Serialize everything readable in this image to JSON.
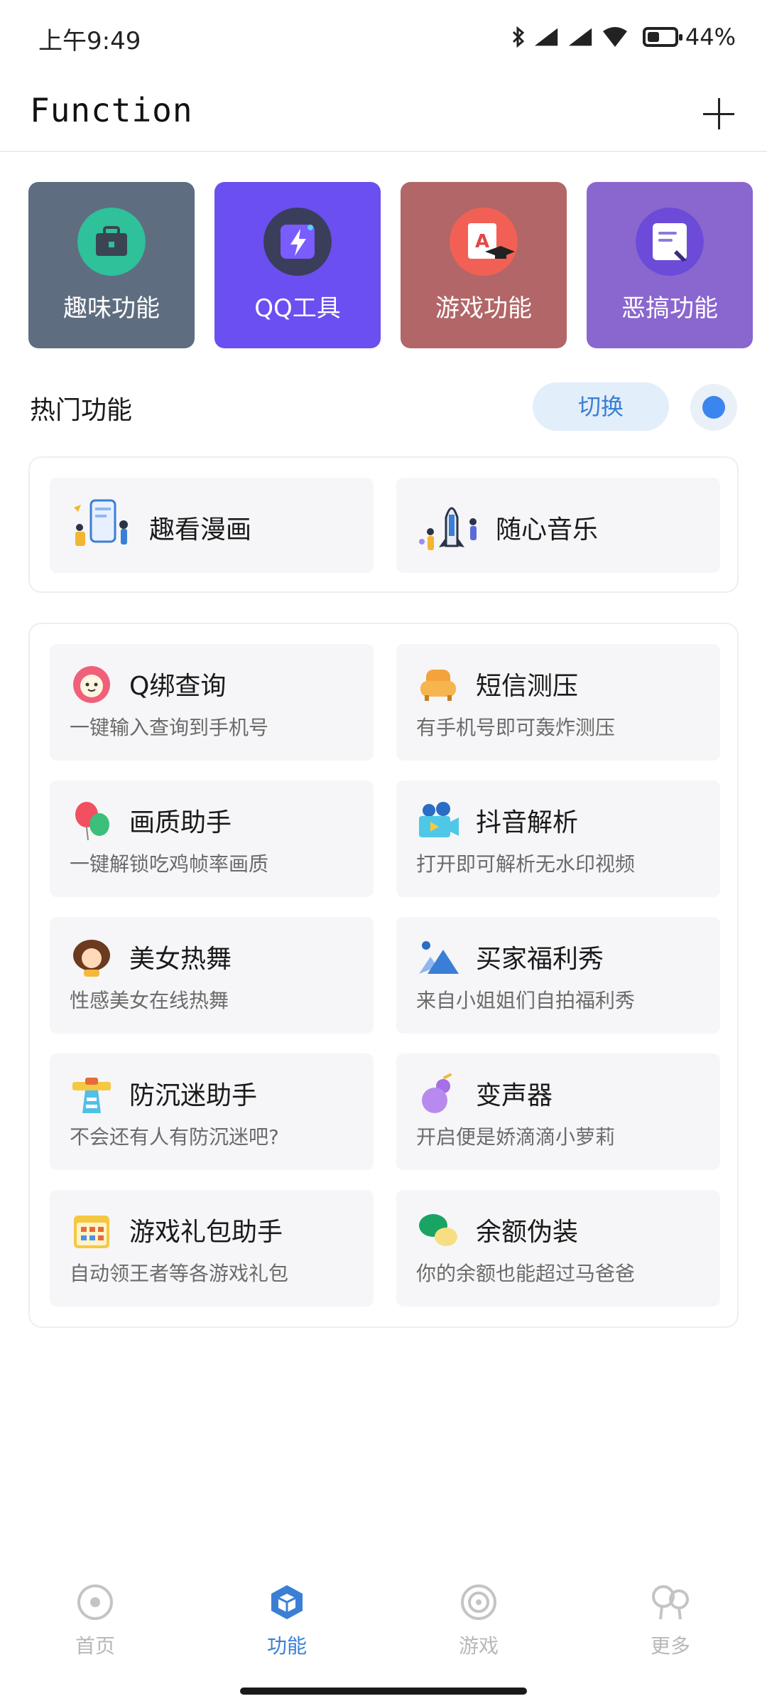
{
  "status_bar": {
    "time": "上午9:49",
    "battery": "44%",
    "battery_level": 0.44
  },
  "header": {
    "title": "Function"
  },
  "categories": [
    {
      "label": "趣味功能",
      "bg": "#5f6d80",
      "icon": "briefcase-icon"
    },
    {
      "label": "QQ工具",
      "bg": "#6b4ff0",
      "icon": "lightning-icon"
    },
    {
      "label": "游戏功能",
      "bg": "#b26667",
      "icon": "exam-grade-icon"
    },
    {
      "label": "恶搞功能",
      "bg": "#8a66cf",
      "icon": "note-icon"
    }
  ],
  "hot": {
    "title": "热门功能",
    "switch_label": "切换",
    "items": [
      {
        "label": "趣看漫画",
        "icon": "phone-illustration-icon"
      },
      {
        "label": "随心音乐",
        "icon": "rocket-illustration-icon"
      }
    ]
  },
  "functions": [
    {
      "title": "Q绑查询",
      "desc": "一键输入查询到手机号",
      "icon": "flower-face-icon"
    },
    {
      "title": "短信测压",
      "desc": "有手机号即可轰炸测压",
      "icon": "sofa-icon"
    },
    {
      "title": "画质助手",
      "desc": "一键解锁吃鸡帧率画质",
      "icon": "balloon-icon"
    },
    {
      "title": "抖音解析",
      "desc": "打开即可解析无水印视频",
      "icon": "video-camera-icon"
    },
    {
      "title": "美女热舞",
      "desc": "性感美女在线热舞",
      "icon": "girl-avatar-icon"
    },
    {
      "title": "买家福利秀",
      "desc": "来自小姐姐们自拍福利秀",
      "icon": "mountain-image-icon"
    },
    {
      "title": "防沉迷助手",
      "desc": "不会还有人有防沉迷吧?",
      "icon": "lighthouse-icon"
    },
    {
      "title": "变声器",
      "desc": "开启便是娇滴滴小萝莉",
      "icon": "gourd-icon"
    },
    {
      "title": "游戏礼包助手",
      "desc": "自动领王者等各游戏礼包",
      "icon": "calendar-icon"
    },
    {
      "title": "余额伪装",
      "desc": "你的余额也能超过马爸爸",
      "icon": "chat-bubbles-icon"
    }
  ],
  "nav": [
    {
      "label": "首页",
      "icon": "home-target-icon",
      "active": false
    },
    {
      "label": "功能",
      "icon": "cube-icon",
      "active": true
    },
    {
      "label": "游戏",
      "icon": "game-swirl-icon",
      "active": false
    },
    {
      "label": "更多",
      "icon": "more-bubbles-icon",
      "active": false
    }
  ],
  "colors": {
    "accent": "#3a7fd5",
    "panel_item_bg": "#f6f6f8"
  }
}
